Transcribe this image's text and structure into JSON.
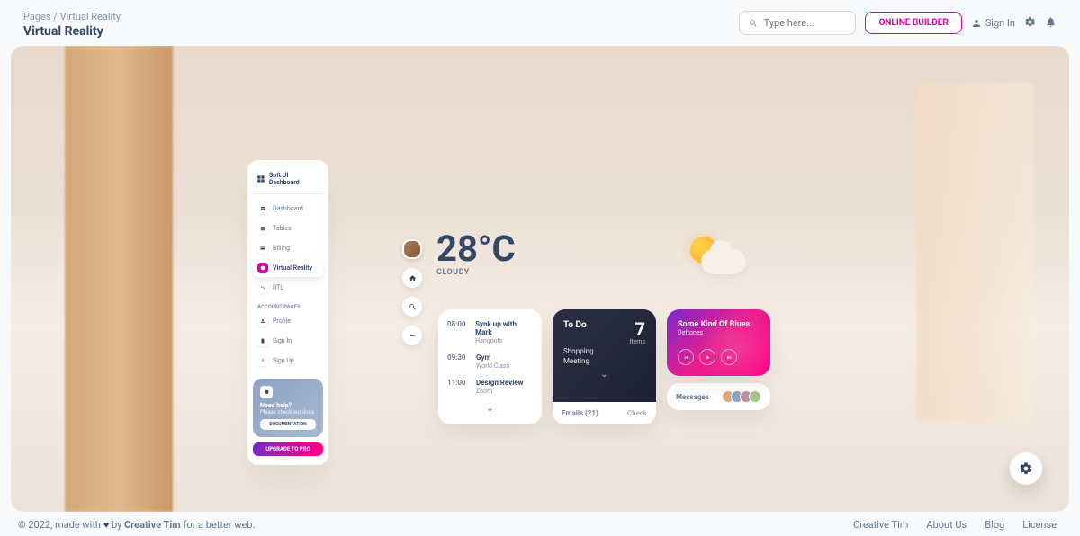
{
  "breadcrumb": {
    "root": "Pages",
    "current": "Virtual Reality"
  },
  "page_title": "Virtual Reality",
  "search": {
    "placeholder": "Type here..."
  },
  "top": {
    "builder": "ONLINE BUILDER",
    "signin": "Sign In"
  },
  "sidebar": {
    "brand": "Soft UI Dashboard",
    "items": [
      "Dashboard",
      "Tables",
      "Billing",
      "Virtual Reality",
      "RTL"
    ],
    "account_label": "ACCOUNT PAGES",
    "account_items": [
      "Profile",
      "Sign In",
      "Sign Up"
    ],
    "help": {
      "title": "Need help?",
      "sub": "Please check our docs",
      "doc_btn": "DOCUMENTATION"
    },
    "upgrade": "UPGRADE TO PRO"
  },
  "weather": {
    "temp": "28°C",
    "desc": "CLOUDY"
  },
  "calendar": [
    {
      "time": "08:00",
      "title": "Synk up with Mark",
      "sub": "Hangouts"
    },
    {
      "time": "09:30",
      "title": "Gym",
      "sub": "World Class"
    },
    {
      "time": "11:00",
      "title": "Design Review",
      "sub": "Zoom"
    }
  ],
  "todo": {
    "title": "To Do",
    "count": "7",
    "items_label": "Items",
    "list": [
      "Shopping",
      "Meeting"
    ]
  },
  "emails": {
    "label": "Emails (21)",
    "action": "Check"
  },
  "music": {
    "title": "Some Kind Of Blues",
    "artist": "Deftones"
  },
  "messages": {
    "label": "Messages"
  },
  "footer": {
    "copyright": "© 2022, made with ",
    "by": " by ",
    "author": "Creative Tim",
    "tagline": " for a better web.",
    "links": [
      "Creative Tim",
      "About Us",
      "Blog",
      "License"
    ]
  }
}
